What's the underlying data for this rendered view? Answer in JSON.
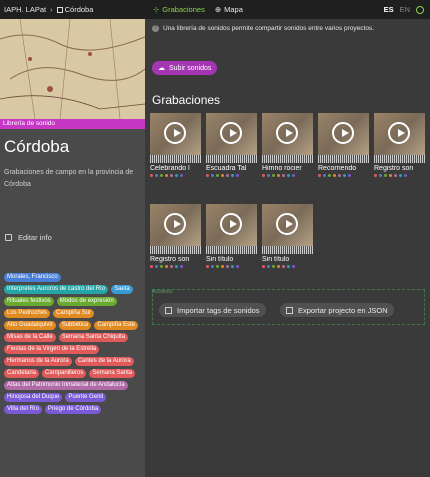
{
  "topbar": {
    "breadcrumb_root": "IAPH. LAPat",
    "breadcrumb_sep": "›",
    "breadcrumb_current": "Córdoba",
    "nav_recordings": "Grabaciones",
    "nav_map": "Mapa",
    "lang_es": "ES",
    "lang_en": "EN"
  },
  "sidebar": {
    "library_label": "Librería de sonido",
    "title": "Córdoba",
    "description": "Grabaciones de campo en la provincia de Córdoba",
    "edit_label": "Editar info",
    "tags": [
      {
        "label": "Morales, Francisco",
        "color": "#4a7fd6"
      },
      {
        "label": "Interpretes Auroros de castro del Río",
        "color": "#25a5a5"
      },
      {
        "label": "Saeta",
        "color": "#3a9ad6"
      },
      {
        "label": "Rituales festivos",
        "color": "#6aaa30"
      },
      {
        "label": "Modos de expresión",
        "color": "#6aaa30"
      },
      {
        "label": "Los Pedroches",
        "color": "#e08a22"
      },
      {
        "label": "Campiña Sur",
        "color": "#e08a22"
      },
      {
        "label": "Alto Guadalquivir",
        "color": "#e08a22"
      },
      {
        "label": "Subbética",
        "color": "#e08a22"
      },
      {
        "label": "Campiña Este",
        "color": "#e08a22"
      },
      {
        "label": "Misas de la Calle",
        "color": "#e05a5a"
      },
      {
        "label": "Semana Santa Chiquita",
        "color": "#e05a5a"
      },
      {
        "label": "Fiestas de la Virgen de la Estrella",
        "color": "#e05a5a"
      },
      {
        "label": "Hermanos de la Aurora",
        "color": "#e05a5a"
      },
      {
        "label": "Cantes de la Aurora",
        "color": "#e05a5a"
      },
      {
        "label": "Candelaria",
        "color": "#e05a5a"
      },
      {
        "label": "Campanilleros",
        "color": "#e05a5a"
      },
      {
        "label": "Semana Santa",
        "color": "#e05a5a"
      },
      {
        "label": "Atlas del Patrimonio Inmaterial de Andalucía",
        "color": "#b06aa8"
      },
      {
        "label": "Hinojosa del Duque",
        "color": "#7a5ad6"
      },
      {
        "label": "Puente Genil",
        "color": "#7a5ad6"
      },
      {
        "label": "Villa del Río",
        "color": "#7a5ad6"
      },
      {
        "label": "Priego de Córdoba",
        "color": "#7a5ad6"
      }
    ]
  },
  "main": {
    "info": "Una librería de sonidos permite compartir sonidos entre varios proyectos.",
    "upload_label": "Subir sonidos",
    "section_title": "Grabaciones",
    "cards": [
      {
        "title": "Celebrando l"
      },
      {
        "title": "Escuadra Tal"
      },
      {
        "title": "Himno rocier"
      },
      {
        "title": "Recorriendo"
      },
      {
        "title": "Registro son"
      },
      {
        "title": "Registro son"
      },
      {
        "title": "Sin título"
      },
      {
        "title": "Sin título"
      }
    ],
    "import_section_label": "Acciones",
    "import_tags_label": "Importar tags de sonidos",
    "export_label": "Exportar projecto en JSON"
  },
  "colors": {
    "accent_green": "#8bd34a",
    "library_magenta": "#c637c6",
    "upload_purple": "#a436b2"
  }
}
